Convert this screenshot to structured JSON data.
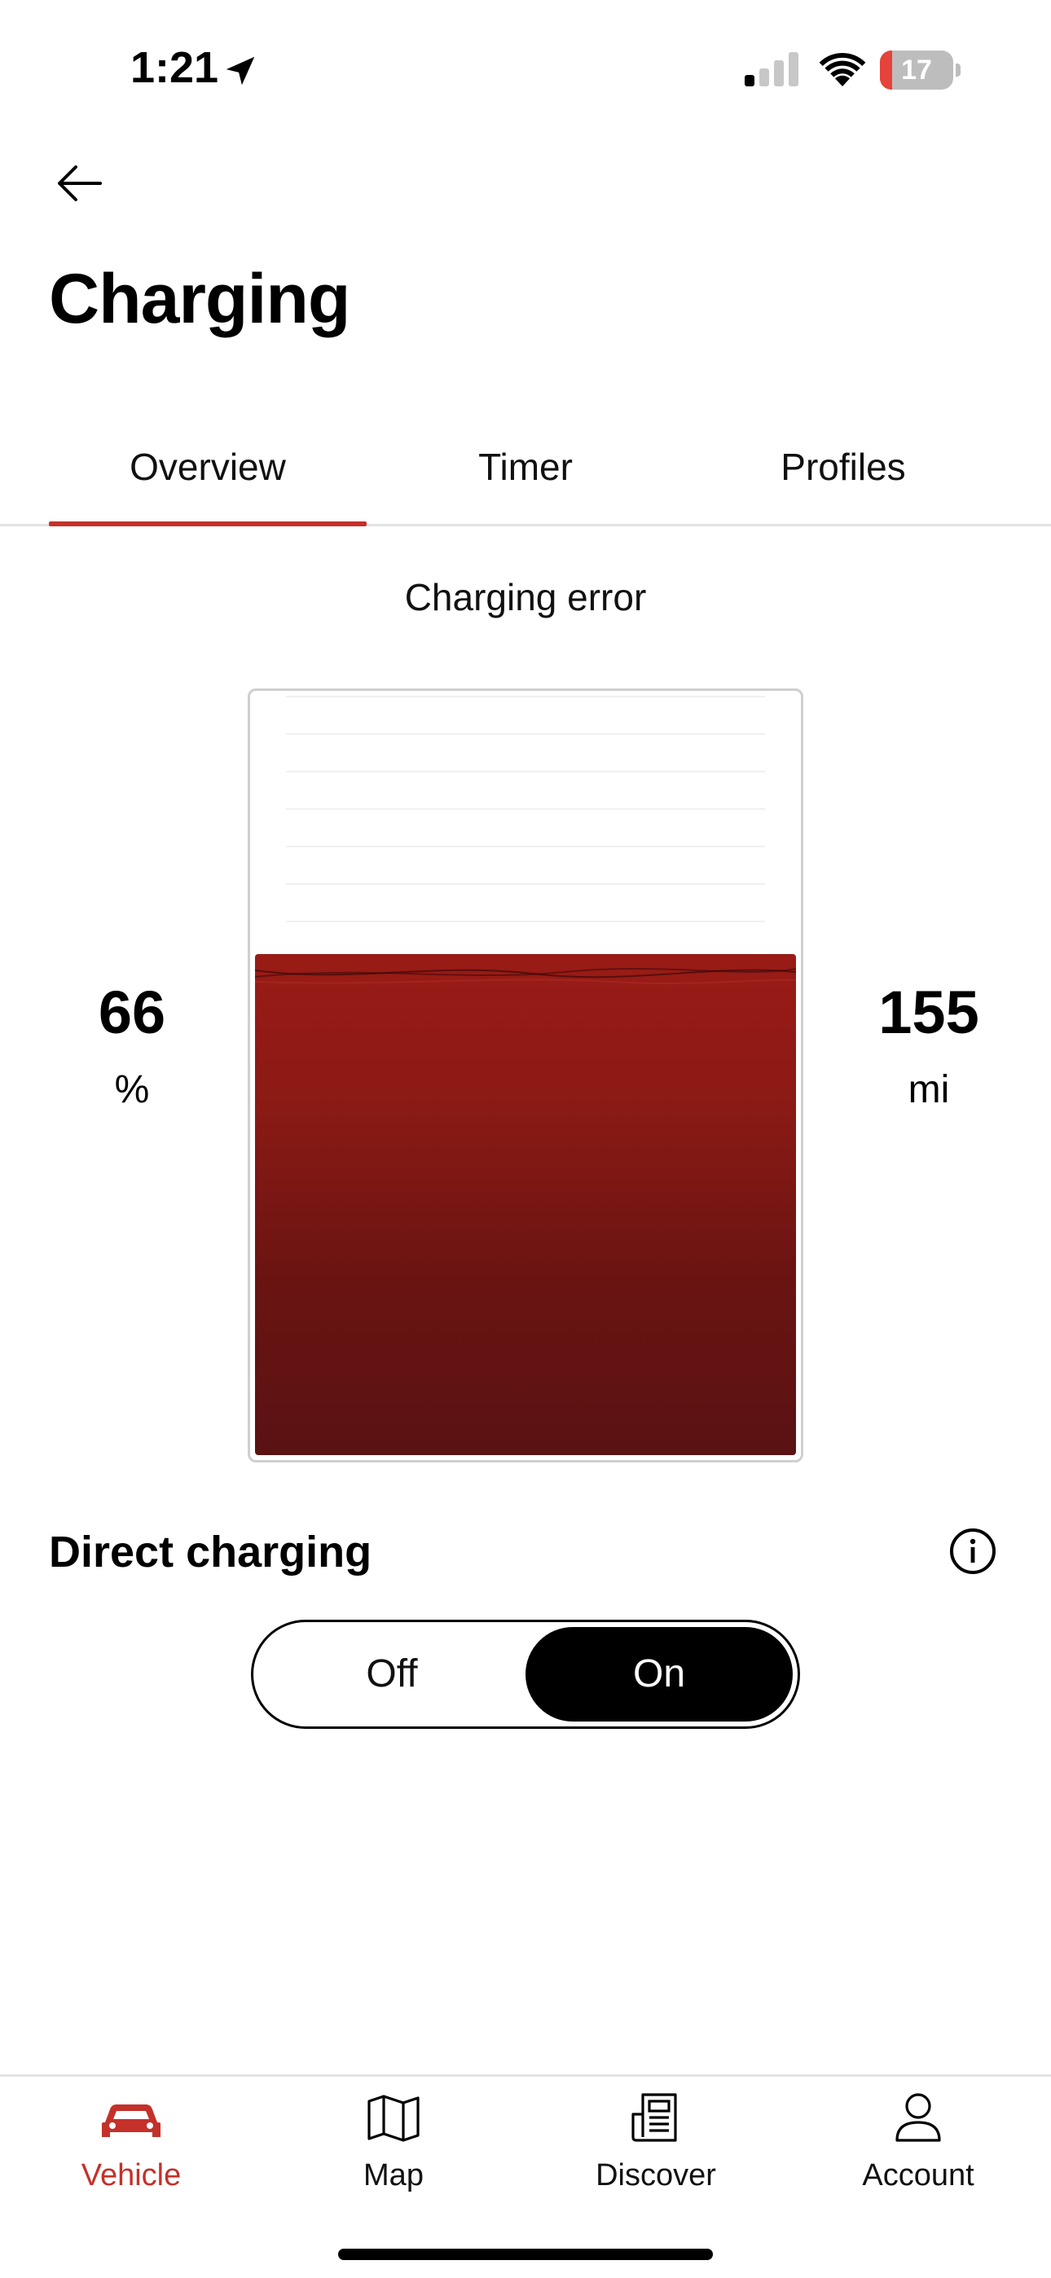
{
  "status_bar": {
    "time": "1:21",
    "battery_percent": 17,
    "signal_bars_active": 1,
    "signal_bars_total": 4
  },
  "header": {
    "title": "Charging"
  },
  "tabs": [
    {
      "label": "Overview",
      "active": true
    },
    {
      "label": "Timer",
      "active": false
    },
    {
      "label": "Profiles",
      "active": false
    }
  ],
  "overview": {
    "status": "Charging error",
    "state_of_charge": {
      "value": "66",
      "unit": "%"
    },
    "range": {
      "value": "155",
      "unit": "mi"
    },
    "battery_fill_fraction": 0.66
  },
  "direct_charging": {
    "title": "Direct charging",
    "options": [
      "Off",
      "On"
    ],
    "selected": "On"
  },
  "bottom_nav": [
    {
      "label": "Vehicle",
      "icon": "car-icon",
      "active": true
    },
    {
      "label": "Map",
      "icon": "map-icon",
      "active": false
    },
    {
      "label": "Discover",
      "icon": "news-icon",
      "active": false
    },
    {
      "label": "Account",
      "icon": "user-icon",
      "active": false
    }
  ],
  "colors": {
    "accent": "#c4312a",
    "battery_top": "#9a1b16",
    "battery_bottom": "#5a1213"
  }
}
